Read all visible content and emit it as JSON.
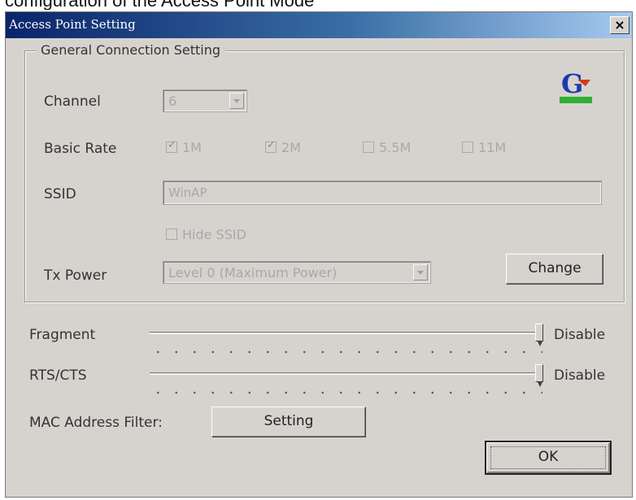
{
  "document": {
    "heading": "configuration of the Access Point Mode"
  },
  "window": {
    "title": "Access Point Setting",
    "close_label": "×"
  },
  "general": {
    "group_label": "General Connection Setting",
    "channel": {
      "label": "Channel",
      "value": "6"
    },
    "basic_rate": {
      "label": "Basic Rate",
      "options": [
        {
          "label": "1M",
          "checked": true
        },
        {
          "label": "2M",
          "checked": true
        },
        {
          "label": "5.5M",
          "checked": false
        },
        {
          "label": "11M",
          "checked": false
        }
      ]
    },
    "ssid": {
      "label": "SSID",
      "value": "WinAP"
    },
    "hide_ssid": {
      "label": "Hide SSID",
      "checked": false
    },
    "tx_power": {
      "label": "Tx Power",
      "value": "Level 0 (Maximum Power)"
    },
    "change_button": "Change",
    "logo_icon": "gigabyte-logo-icon",
    "logo_colors": {
      "letter": "#1a3bb0",
      "accent": "#d33a1c",
      "bar": "#2fb034"
    }
  },
  "fragment": {
    "label": "Fragment",
    "value": "Disable",
    "level": 1.0
  },
  "rts_cts": {
    "label": "RTS/CTS",
    "value": "Disable",
    "level": 1.0
  },
  "mac_filter": {
    "label": "MAC Address Filter:",
    "button": "Setting"
  },
  "ok_button": "OK"
}
